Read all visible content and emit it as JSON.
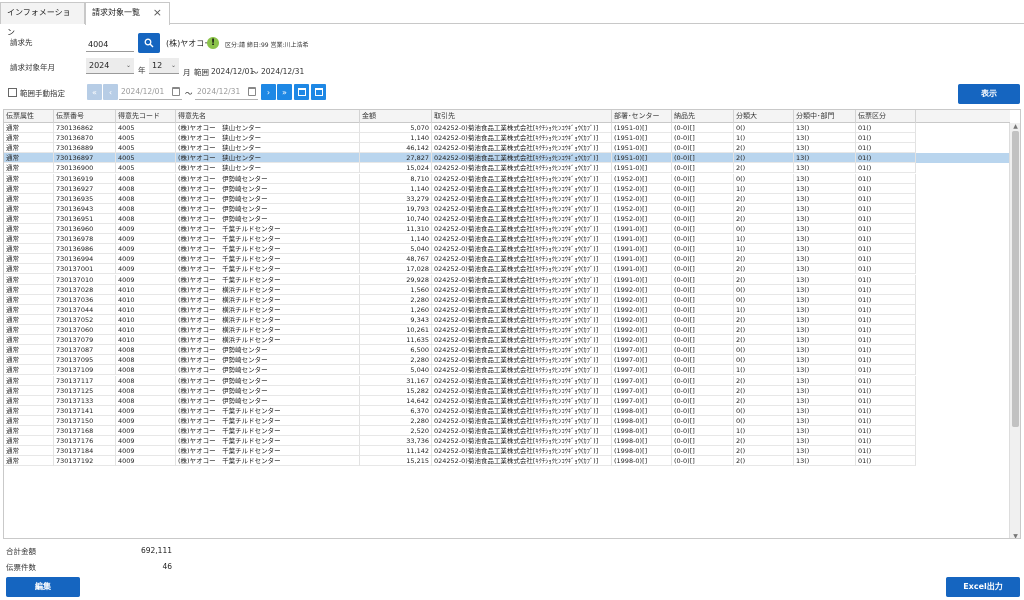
{
  "tabs": [
    {
      "label": "インフォメーション",
      "active": false
    },
    {
      "label": "請求対象一覧",
      "active": true
    }
  ],
  "form": {
    "customer_label": "請求先",
    "customer_code": "4004",
    "customer_name": "(株)ヤオコー",
    "customer_note": "区分:請 締日:99 営業:川上浩希",
    "period_label": "請求対象年月",
    "year": "2024",
    "year_suffix": "年",
    "month": "12",
    "month_suffix": "月",
    "range_label": "範囲",
    "range_from": "2024/12/01",
    "range_sep": "〜",
    "range_to": "2024/12/31",
    "manual_range_label": "範囲手動指定",
    "date_from_placeholder": "2024/12/01",
    "date_tilde": "〜",
    "date_to_placeholder": "2024/12/31",
    "show_button": "表示"
  },
  "grid": {
    "columns": [
      "伝票属性",
      "伝票番号",
      "得意先コード",
      "得意先名",
      "金額",
      "取引先",
      "部署･センター",
      "納品先",
      "分類大",
      "分類中･部門",
      "伝票区分"
    ],
    "rows": [
      [
        "通常",
        "730136862",
        "4005",
        "(株)ヤオコー　狭山センター",
        "5,070",
        "024252-0)菊池食品工業株式会社[ｷｸﾁｼｮｸﾋﾝｺｳｷﾞｮｳ(ｶﾌﾞ)]",
        "(1951-0)[]",
        "(0-0)[]",
        "0()",
        "13()",
        "01()"
      ],
      [
        "通常",
        "730136870",
        "4005",
        "(株)ヤオコー　狭山センター",
        "1,140",
        "024252-0)菊池食品工業株式会社[ｷｸﾁｼｮｸﾋﾝｺｳｷﾞｮｳ(ｶﾌﾞ)]",
        "(1951-0)[]",
        "(0-0)[]",
        "1()",
        "13()",
        "01()"
      ],
      [
        "通常",
        "730136889",
        "4005",
        "(株)ヤオコー　狭山センター",
        "46,142",
        "024252-0)菊池食品工業株式会社[ｷｸﾁｼｮｸﾋﾝｺｳｷﾞｮｳ(ｶﾌﾞ)]",
        "(1951-0)[]",
        "(0-0)[]",
        "2()",
        "13()",
        "01()"
      ],
      [
        "通常",
        "730136897",
        "4005",
        "(株)ヤオコー　狭山センター",
        "27,827",
        "024252-0)菊池食品工業株式会社[ｷｸﾁｼｮｸﾋﾝｺｳｷﾞｮｳ(ｶﾌﾞ)]",
        "(1951-0)[]",
        "(0-0)[]",
        "2()",
        "13()",
        "01()"
      ],
      [
        "通常",
        "730136900",
        "4005",
        "(株)ヤオコー　狭山センター",
        "15,024",
        "024252-0)菊池食品工業株式会社[ｷｸﾁｼｮｸﾋﾝｺｳｷﾞｮｳ(ｶﾌﾞ)]",
        "(1951-0)[]",
        "(0-0)[]",
        "2()",
        "13()",
        "01()"
      ],
      [
        "通常",
        "730136919",
        "4008",
        "(株)ヤオコー　伊勢崎センター",
        "8,710",
        "024252-0)菊池食品工業株式会社[ｷｸﾁｼｮｸﾋﾝｺｳｷﾞｮｳ(ｶﾌﾞ)]",
        "(1952-0)[]",
        "(0-0)[]",
        "0()",
        "13()",
        "01()"
      ],
      [
        "通常",
        "730136927",
        "4008",
        "(株)ヤオコー　伊勢崎センター",
        "1,140",
        "024252-0)菊池食品工業株式会社[ｷｸﾁｼｮｸﾋﾝｺｳｷﾞｮｳ(ｶﾌﾞ)]",
        "(1952-0)[]",
        "(0-0)[]",
        "1()",
        "13()",
        "01()"
      ],
      [
        "通常",
        "730136935",
        "4008",
        "(株)ヤオコー　伊勢崎センター",
        "33,279",
        "024252-0)菊池食品工業株式会社[ｷｸﾁｼｮｸﾋﾝｺｳｷﾞｮｳ(ｶﾌﾞ)]",
        "(1952-0)[]",
        "(0-0)[]",
        "2()",
        "13()",
        "01()"
      ],
      [
        "通常",
        "730136943",
        "4008",
        "(株)ヤオコー　伊勢崎センター",
        "19,793",
        "024252-0)菊池食品工業株式会社[ｷｸﾁｼｮｸﾋﾝｺｳｷﾞｮｳ(ｶﾌﾞ)]",
        "(1952-0)[]",
        "(0-0)[]",
        "2()",
        "13()",
        "01()"
      ],
      [
        "通常",
        "730136951",
        "4008",
        "(株)ヤオコー　伊勢崎センター",
        "10,740",
        "024252-0)菊池食品工業株式会社[ｷｸﾁｼｮｸﾋﾝｺｳｷﾞｮｳ(ｶﾌﾞ)]",
        "(1952-0)[]",
        "(0-0)[]",
        "2()",
        "13()",
        "01()"
      ],
      [
        "通常",
        "730136960",
        "4009",
        "(株)ヤオコー　千葉チルドセンター",
        "11,310",
        "024252-0)菊池食品工業株式会社[ｷｸﾁｼｮｸﾋﾝｺｳｷﾞｮｳ(ｶﾌﾞ)]",
        "(1991-0)[]",
        "(0-0)[]",
        "0()",
        "13()",
        "01()"
      ],
      [
        "通常",
        "730136978",
        "4009",
        "(株)ヤオコー　千葉チルドセンター",
        "1,140",
        "024252-0)菊池食品工業株式会社[ｷｸﾁｼｮｸﾋﾝｺｳｷﾞｮｳ(ｶﾌﾞ)]",
        "(1991-0)[]",
        "(0-0)[]",
        "1()",
        "13()",
        "01()"
      ],
      [
        "通常",
        "730136986",
        "4009",
        "(株)ヤオコー　千葉チルドセンター",
        "5,040",
        "024252-0)菊池食品工業株式会社[ｷｸﾁｼｮｸﾋﾝｺｳｷﾞｮｳ(ｶﾌﾞ)]",
        "(1991-0)[]",
        "(0-0)[]",
        "1()",
        "13()",
        "01()"
      ],
      [
        "通常",
        "730136994",
        "4009",
        "(株)ヤオコー　千葉チルドセンター",
        "48,767",
        "024252-0)菊池食品工業株式会社[ｷｸﾁｼｮｸﾋﾝｺｳｷﾞｮｳ(ｶﾌﾞ)]",
        "(1991-0)[]",
        "(0-0)[]",
        "2()",
        "13()",
        "01()"
      ],
      [
        "通常",
        "730137001",
        "4009",
        "(株)ヤオコー　千葉チルドセンター",
        "17,028",
        "024252-0)菊池食品工業株式会社[ｷｸﾁｼｮｸﾋﾝｺｳｷﾞｮｳ(ｶﾌﾞ)]",
        "(1991-0)[]",
        "(0-0)[]",
        "2()",
        "13()",
        "01()"
      ],
      [
        "通常",
        "730137010",
        "4009",
        "(株)ヤオコー　千葉チルドセンター",
        "29,928",
        "024252-0)菊池食品工業株式会社[ｷｸﾁｼｮｸﾋﾝｺｳｷﾞｮｳ(ｶﾌﾞ)]",
        "(1991-0)[]",
        "(0-0)[]",
        "2()",
        "13()",
        "01()"
      ],
      [
        "通常",
        "730137028",
        "4010",
        "(株)ヤオコー　横浜チルドセンター",
        "1,560",
        "024252-0)菊池食品工業株式会社[ｷｸﾁｼｮｸﾋﾝｺｳｷﾞｮｳ(ｶﾌﾞ)]",
        "(1992-0)[]",
        "(0-0)[]",
        "0()",
        "13()",
        "01()"
      ],
      [
        "通常",
        "730137036",
        "4010",
        "(株)ヤオコー　横浜チルドセンター",
        "2,280",
        "024252-0)菊池食品工業株式会社[ｷｸﾁｼｮｸﾋﾝｺｳｷﾞｮｳ(ｶﾌﾞ)]",
        "(1992-0)[]",
        "(0-0)[]",
        "0()",
        "13()",
        "01()"
      ],
      [
        "通常",
        "730137044",
        "4010",
        "(株)ヤオコー　横浜チルドセンター",
        "1,260",
        "024252-0)菊池食品工業株式会社[ｷｸﾁｼｮｸﾋﾝｺｳｷﾞｮｳ(ｶﾌﾞ)]",
        "(1992-0)[]",
        "(0-0)[]",
        "1()",
        "13()",
        "01()"
      ],
      [
        "通常",
        "730137052",
        "4010",
        "(株)ヤオコー　横浜チルドセンター",
        "9,343",
        "024252-0)菊池食品工業株式会社[ｷｸﾁｼｮｸﾋﾝｺｳｷﾞｮｳ(ｶﾌﾞ)]",
        "(1992-0)[]",
        "(0-0)[]",
        "2()",
        "13()",
        "01()"
      ],
      [
        "通常",
        "730137060",
        "4010",
        "(株)ヤオコー　横浜チルドセンター",
        "10,261",
        "024252-0)菊池食品工業株式会社[ｷｸﾁｼｮｸﾋﾝｺｳｷﾞｮｳ(ｶﾌﾞ)]",
        "(1992-0)[]",
        "(0-0)[]",
        "2()",
        "13()",
        "01()"
      ],
      [
        "通常",
        "730137079",
        "4010",
        "(株)ヤオコー　横浜チルドセンター",
        "11,635",
        "024252-0)菊池食品工業株式会社[ｷｸﾁｼｮｸﾋﾝｺｳｷﾞｮｳ(ｶﾌﾞ)]",
        "(1992-0)[]",
        "(0-0)[]",
        "2()",
        "13()",
        "01()"
      ],
      [
        "通常",
        "730137087",
        "4008",
        "(株)ヤオコー　伊勢崎センター",
        "6,500",
        "024252-0)菊池食品工業株式会社[ｷｸﾁｼｮｸﾋﾝｺｳｷﾞｮｳ(ｶﾌﾞ)]",
        "(1997-0)[]",
        "(0-0)[]",
        "0()",
        "13()",
        "01()"
      ],
      [
        "通常",
        "730137095",
        "4008",
        "(株)ヤオコー　伊勢崎センター",
        "2,280",
        "024252-0)菊池食品工業株式会社[ｷｸﾁｼｮｸﾋﾝｺｳｷﾞｮｳ(ｶﾌﾞ)]",
        "(1997-0)[]",
        "(0-0)[]",
        "0()",
        "13()",
        "01()"
      ],
      [
        "通常",
        "730137109",
        "4008",
        "(株)ヤオコー　伊勢崎センター",
        "5,040",
        "024252-0)菊池食品工業株式会社[ｷｸﾁｼｮｸﾋﾝｺｳｷﾞｮｳ(ｶﾌﾞ)]",
        "(1997-0)[]",
        "(0-0)[]",
        "1()",
        "13()",
        "01()"
      ],
      [
        "通常",
        "730137117",
        "4008",
        "(株)ヤオコー　伊勢崎センター",
        "31,167",
        "024252-0)菊池食品工業株式会社[ｷｸﾁｼｮｸﾋﾝｺｳｷﾞｮｳ(ｶﾌﾞ)]",
        "(1997-0)[]",
        "(0-0)[]",
        "2()",
        "13()",
        "01()"
      ],
      [
        "通常",
        "730137125",
        "4008",
        "(株)ヤオコー　伊勢崎センター",
        "15,282",
        "024252-0)菊池食品工業株式会社[ｷｸﾁｼｮｸﾋﾝｺｳｷﾞｮｳ(ｶﾌﾞ)]",
        "(1997-0)[]",
        "(0-0)[]",
        "2()",
        "13()",
        "01()"
      ],
      [
        "通常",
        "730137133",
        "4008",
        "(株)ヤオコー　伊勢崎センター",
        "14,642",
        "024252-0)菊池食品工業株式会社[ｷｸﾁｼｮｸﾋﾝｺｳｷﾞｮｳ(ｶﾌﾞ)]",
        "(1997-0)[]",
        "(0-0)[]",
        "2()",
        "13()",
        "01()"
      ],
      [
        "通常",
        "730137141",
        "4009",
        "(株)ヤオコー　千葉チルドセンター",
        "6,370",
        "024252-0)菊池食品工業株式会社[ｷｸﾁｼｮｸﾋﾝｺｳｷﾞｮｳ(ｶﾌﾞ)]",
        "(1998-0)[]",
        "(0-0)[]",
        "0()",
        "13()",
        "01()"
      ],
      [
        "通常",
        "730137150",
        "4009",
        "(株)ヤオコー　千葉チルドセンター",
        "2,280",
        "024252-0)菊池食品工業株式会社[ｷｸﾁｼｮｸﾋﾝｺｳｷﾞｮｳ(ｶﾌﾞ)]",
        "(1998-0)[]",
        "(0-0)[]",
        "0()",
        "13()",
        "01()"
      ],
      [
        "通常",
        "730137168",
        "4009",
        "(株)ヤオコー　千葉チルドセンター",
        "2,520",
        "024252-0)菊池食品工業株式会社[ｷｸﾁｼｮｸﾋﾝｺｳｷﾞｮｳ(ｶﾌﾞ)]",
        "(1998-0)[]",
        "(0-0)[]",
        "1()",
        "13()",
        "01()"
      ],
      [
        "通常",
        "730137176",
        "4009",
        "(株)ヤオコー　千葉チルドセンター",
        "33,736",
        "024252-0)菊池食品工業株式会社[ｷｸﾁｼｮｸﾋﾝｺｳｷﾞｮｳ(ｶﾌﾞ)]",
        "(1998-0)[]",
        "(0-0)[]",
        "2()",
        "13()",
        "01()"
      ],
      [
        "通常",
        "730137184",
        "4009",
        "(株)ヤオコー　千葉チルドセンター",
        "11,142",
        "024252-0)菊池食品工業株式会社[ｷｸﾁｼｮｸﾋﾝｺｳｷﾞｮｳ(ｶﾌﾞ)]",
        "(1998-0)[]",
        "(0-0)[]",
        "2()",
        "13()",
        "01()"
      ],
      [
        "通常",
        "730137192",
        "4009",
        "(株)ヤオコー　千葉チルドセンター",
        "15,215",
        "024252-0)菊池食品工業株式会社[ｷｸﾁｼｮｸﾋﾝｺｳｷﾞｮｳ(ｶﾌﾞ)]",
        "(1998-0)[]",
        "(0-0)[]",
        "2()",
        "13()",
        "01()"
      ]
    ]
  },
  "summary": {
    "total_amount_label": "合計金額",
    "total_amount": "692,111",
    "slip_count_label": "伝票件数",
    "slip_count": "46"
  },
  "footer": {
    "edit_button": "編集",
    "excel_button": "Excel出力"
  },
  "colors": {
    "accent": "#1565c0",
    "selected_row": "#b9d5ee"
  }
}
